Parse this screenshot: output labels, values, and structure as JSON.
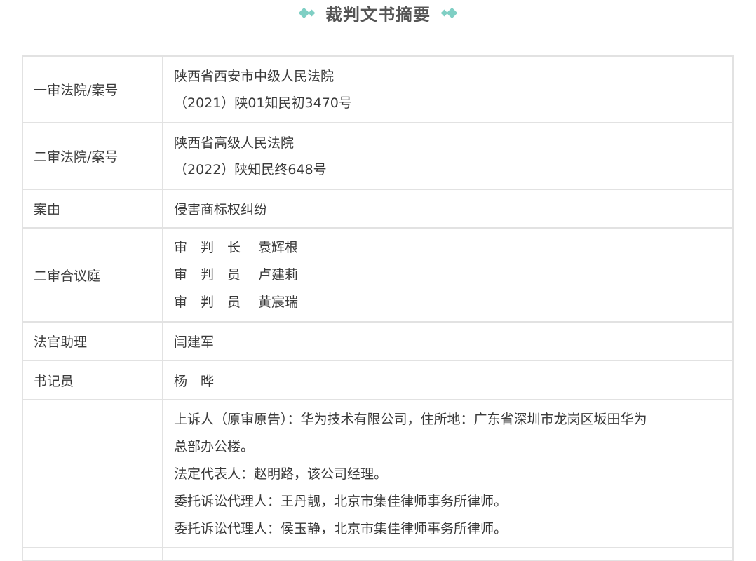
{
  "header": {
    "title": "裁判文书摘要"
  },
  "rows": {
    "first_instance": {
      "label": "一审法院/案号",
      "court": "陕西省西安市中级人民法院",
      "case_no": "（2021）陕01知民初3470号"
    },
    "second_instance": {
      "label": "二审法院/案号",
      "court": "陕西省高级人民法院",
      "case_no": "（2022）陕知民终648号"
    },
    "cause": {
      "label": "案由",
      "value": "侵害商标权纠纷"
    },
    "panel": {
      "label": "二审合议庭",
      "members": [
        {
          "title": "审　判　长",
          "name": "袁辉根"
        },
        {
          "title": "审　判　员",
          "name": "卢建莉"
        },
        {
          "title": "审　判　员",
          "name": "黄宸瑞"
        }
      ]
    },
    "assistant": {
      "label": "法官助理",
      "value": "闫建军"
    },
    "clerk": {
      "label": "书记员",
      "value": "杨　晔"
    },
    "parties": {
      "label": "",
      "lines": [
        "上诉人（原审原告）：华为技术有限公司，住所地：广东省深圳市龙岗区坂田华为",
        "总部办公楼。",
        "法定代表人：赵明路，该公司经理。",
        "委托诉讼代理人：王丹靓，北京市集佳律师事务所律师。",
        "委托诉讼代理人：侯玉静，北京市集佳律师事务所律师。"
      ]
    }
  }
}
